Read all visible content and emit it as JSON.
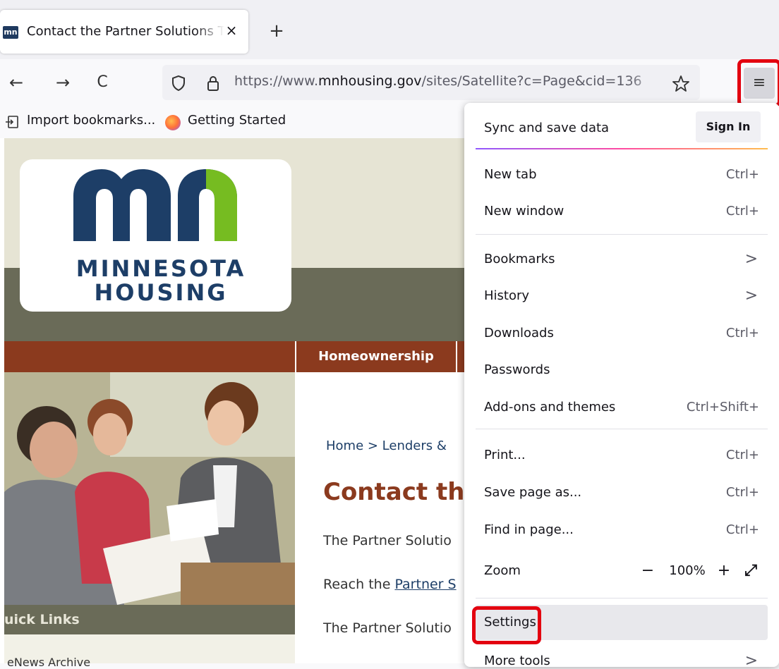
{
  "browser": {
    "tab": {
      "favicon": "mn",
      "title": "Contact the Partner Solutions Te",
      "close": "×"
    },
    "new_tab": "+",
    "nav": {
      "back": "←",
      "forward": "→",
      "reload": "C"
    },
    "url": {
      "prefix": "https://www.",
      "domain": "mnhousing.gov",
      "path": "/sites/Satellite?c=Page&cid=136"
    },
    "menu_button": "≡",
    "bookmarks": [
      {
        "label": "Import bookmarks..."
      },
      {
        "label": "Getting Started"
      }
    ]
  },
  "page": {
    "logo": {
      "mark": "mn",
      "line1": "MINNESOTA",
      "line2": "HOUSING"
    },
    "nav_item": "Homeownership",
    "breadcrumb": "Home  >  Lenders &",
    "title": "Contact the",
    "paragraphs": [
      "The Partner Solutio",
      "Reach the ",
      "The Partner Solutio"
    ],
    "link_text": "Partner S",
    "quick_links": {
      "title": "uick Links",
      "first_item": "eNews Archive"
    }
  },
  "menu": {
    "sync_label": "Sync and save data",
    "sign_in": "Sign In",
    "items": [
      {
        "label": "New tab",
        "shortcut": "Ctrl+"
      },
      {
        "label": "New window",
        "shortcut": "Ctrl+"
      },
      {
        "label": "Bookmarks",
        "chevron": ">"
      },
      {
        "label": "History",
        "chevron": ">"
      },
      {
        "label": "Downloads",
        "shortcut": "Ctrl+"
      },
      {
        "label": "Passwords"
      },
      {
        "label": "Add-ons and themes",
        "shortcut": "Ctrl+Shift+"
      },
      {
        "label": "Print...",
        "shortcut": "Ctrl+"
      },
      {
        "label": "Save page as...",
        "shortcut": "Ctrl+"
      },
      {
        "label": "Find in page...",
        "shortcut": "Ctrl+"
      },
      {
        "label": "Zoom"
      },
      {
        "label": "Settings"
      },
      {
        "label": "More tools",
        "chevron": ">"
      }
    ],
    "zoom": {
      "minus": "−",
      "value": "100%",
      "plus": "+",
      "fullscreen": "⤢"
    }
  },
  "highlight_color": "#e3000f"
}
